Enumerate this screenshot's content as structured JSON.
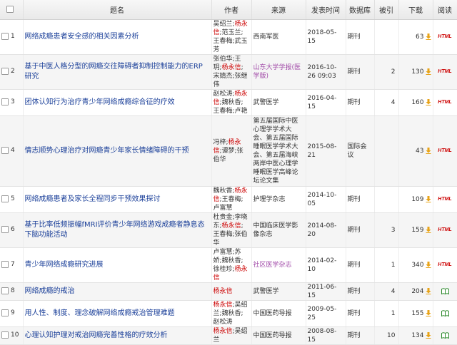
{
  "columns": [
    "题名",
    "作者",
    "来源",
    "发表时间",
    "数据库",
    "被引",
    "下载",
    "阅读"
  ],
  "rows": [
    {
      "no": "1",
      "title": "网络成瘾患者安全感的相关因素分析",
      "authors": [
        [
          "吴绍兰",
          0
        ],
        [
          ";",
          0
        ],
        [
          "杨永信",
          1
        ],
        [
          ";范玉兰;",
          0
        ],
        [
          "王春梅",
          0
        ],
        [
          ";武玉芳",
          0
        ]
      ],
      "source": "西南军医",
      "source_link": false,
      "date": "2018-05-15",
      "db": "期刊",
      "cite": "",
      "downloads": "63",
      "read": "HTML"
    },
    {
      "no": "2",
      "title": "基于中医人格分型的网瘾交往障碍者抑制控制能力的ERP研究",
      "authors": [
        [
          "张伯华;王玥;",
          0
        ],
        [
          "杨永信",
          1
        ],
        [
          ";宋婧杰;张继伟",
          0
        ]
      ],
      "source": "山东大学学报(医学版)",
      "source_link": true,
      "date": "2016-10-26 09:03",
      "db": "期刊",
      "cite": "2",
      "downloads": "130",
      "read": "HTML"
    },
    {
      "no": "3",
      "title": "团体认知行为治疗青少年网络成瘾综合征的疗效",
      "authors": [
        [
          "赵松涛;",
          0
        ],
        [
          "杨永信",
          1
        ],
        [
          ";魏秋香;王春梅;卢艳",
          0
        ]
      ],
      "source": "武警医学",
      "source_link": false,
      "date": "2016-04-15",
      "db": "期刊",
      "cite": "4",
      "downloads": "160",
      "read": "HTML"
    },
    {
      "no": "4",
      "title": "情志顺势心理治疗对网瘾青少年家长情绪障碍的干预",
      "authors": [
        [
          "冯梓;",
          0
        ],
        [
          "杨永信",
          1
        ],
        [
          ";谭梦;张伯华",
          0
        ]
      ],
      "source": "第五届国际中医心理学学术大会、第五届国际睡眠医学学术大会、第五届海峡两岸中医心理学睡眠医学高峰论坛论文集",
      "source_link": false,
      "date": "2015-08-21",
      "db": "国际会议",
      "cite": "",
      "downloads": "43",
      "read": "HTML"
    },
    {
      "no": "5",
      "title": "网络成瘾患者及家长全程同步干预效果探讨",
      "authors": [
        [
          "魏秋香;",
          0
        ],
        [
          "杨永信",
          1
        ],
        [
          ";王春梅;卢富慧",
          0
        ]
      ],
      "source": "护理学杂志",
      "source_link": false,
      "date": "2014-10-05",
      "db": "期刊",
      "cite": "",
      "downloads": "109",
      "read": "HTML"
    },
    {
      "no": "6",
      "title": "基于比率低频振幅fMRI评价青少年网络游戏成瘾者静息态下脑功能活动",
      "authors": [
        [
          "杜贵金;李晓东;",
          0
        ],
        [
          "杨永信",
          1
        ],
        [
          ";王春梅;张伯华",
          0
        ]
      ],
      "source": "中国临床医学影像杂志",
      "source_link": false,
      "date": "2014-08-20",
      "db": "期刊",
      "cite": "3",
      "downloads": "159",
      "read": "HTML"
    },
    {
      "no": "7",
      "title": "青少年网络成瘾研究进展",
      "authors": [
        [
          "卢富慧;苏娇;魏秋香;徐桂珍;",
          0
        ],
        [
          "杨永信",
          1
        ]
      ],
      "source": "社区医学杂志",
      "source_link": true,
      "date": "2014-02-10",
      "db": "期刊",
      "cite": "1",
      "downloads": "340",
      "read": "HTML"
    },
    {
      "no": "8",
      "title": "网络成瘾的戒治",
      "authors": [
        [
          "杨永信",
          1
        ]
      ],
      "source": "武警医学",
      "source_link": false,
      "date": "2011-06-15",
      "db": "期刊",
      "cite": "4",
      "downloads": "204",
      "read": "BOOK"
    },
    {
      "no": "9",
      "title": "用人性、制度、理念破解网络成瘾戒治管理难题",
      "authors": [
        [
          "杨永信",
          1
        ],
        [
          ";吴绍兰;魏秋香;赵松涛",
          0
        ]
      ],
      "source": "中国医药导报",
      "source_link": false,
      "date": "2009-05-25",
      "db": "期刊",
      "cite": "1",
      "downloads": "155",
      "read": "BOOK"
    },
    {
      "no": "10",
      "title": "心理认知护理对戒治网瘾完善性格的疗效分析",
      "authors": [
        [
          "杨永信",
          1
        ],
        [
          ";吴绍兰",
          0
        ]
      ],
      "source": "中国医药导报",
      "source_link": false,
      "date": "2008-08-15",
      "db": "期刊",
      "cite": "10",
      "downloads": "134",
      "read": "BOOK"
    }
  ],
  "colors": {
    "title_link": "#1a3f99",
    "highlight": "#cc0000",
    "download_arrow": "#e8a317",
    "html_tag": "#cc0000",
    "book": "#2e8b2e"
  }
}
